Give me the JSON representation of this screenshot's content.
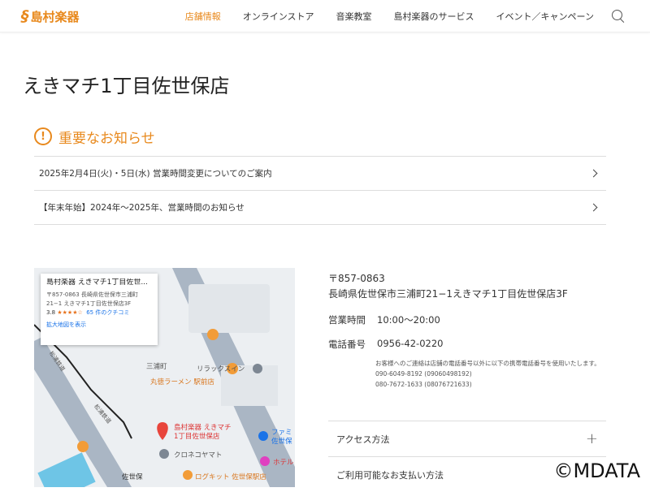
{
  "header": {
    "logo": "島村楽器",
    "nav": [
      "店舗情報",
      "オンラインストア",
      "音楽教室",
      "島村楽器のサービス",
      "イベント／キャンペーン"
    ]
  },
  "page_title": "えきマチ1丁目佐世保店",
  "notice": {
    "title": "重要なお知らせ",
    "items": [
      "2025年2月4日(火)・5日(水) 営業時間変更についてのご案内",
      "【年末年始】2024年～2025年、営業時間のお知らせ"
    ]
  },
  "map": {
    "info_title": "島村楽器 えきマチ1丁目佐世...",
    "info_address": "〒857-0863 長崎県佐世保市三浦町 21−1 えきマチ1丁目佐世保店3F",
    "rating": "3.8",
    "stars": "★★★★☆",
    "reviews": "65 件のクチコミ",
    "enlarge": "拡大地図を表示",
    "labels": [
      "三浦町",
      "リラックスイン",
      "丸徳ラーメン 駅前店",
      "島村楽器 えきマチ",
      "1丁目佐世保店",
      "クロネコヤマト",
      "ファミ",
      "佐世保",
      "ホテル",
      "佐世保",
      "ログキット 佐世保駅店",
      "松浦鉄道",
      "松浦鉄道"
    ]
  },
  "store": {
    "postal": "〒857-0863",
    "address": "長崎県佐世保市三浦町21−1えきマチ1丁目佐世保店3F",
    "hours_label": "営業時間",
    "hours": "10:00〜20:00",
    "phone_label": "電話番号",
    "phone": "0956-42-0220",
    "note": "お客様へのご連絡は店舗の電話番号以外に以下の携帯電話番号を使用いたします。",
    "mobiles": [
      "090-6049-8192 (09060498192)",
      "080-7672-1633 (08076721633)"
    ]
  },
  "accordions": [
    "アクセス方法",
    "ご利用可能なお支払い方法"
  ],
  "watermark": "©MDATA",
  "colors": {
    "accent": "#e8891d"
  }
}
